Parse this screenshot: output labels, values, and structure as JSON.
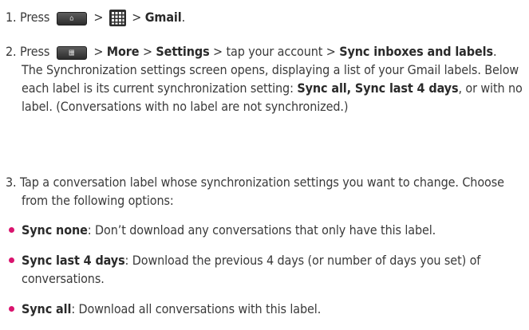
{
  "steps": [
    {
      "num": "1.",
      "press": "Press",
      "sep1": ">",
      "sep2": ">",
      "target": "Gmail",
      "end": "."
    },
    {
      "num": "2.",
      "press": "Press",
      "sep1": ">",
      "more": "More",
      "sep2": ">",
      "settings": "Settings",
      "sep3": "> tap your account >",
      "sync_inboxes": "Sync inboxes and labels",
      "end": ".",
      "para_a": "The Synchronization settings screen opens, displaying a list of your Gmail labels. Below each label is its current synchronization setting: ",
      "sync_all": "Sync all, Sync last 4 days",
      "para_b": ", or with no label. (Conversations with no label are not synchronized.)"
    },
    {
      "num": "3.",
      "text": "Tap a conversation label whose synchronization settings you want to change. Choose from the following options:",
      "options": [
        {
          "term": "Sync none",
          "desc": ": Don’t download any conversations that only have this label."
        },
        {
          "term": "Sync last 4 days",
          "desc": ": Download the previous 4 days (or number of days you set) of conversations."
        },
        {
          "term": "Sync all",
          "desc": ": Download all conversations with this label."
        }
      ]
    }
  ],
  "icons": {
    "home_key": "home-key-icon",
    "menu_key": "menu-key-icon",
    "apps_grid": "apps-grid-icon"
  },
  "colors": {
    "text": "#3a3a3a",
    "bullet": "#d9146e",
    "key": "#3a3a3a"
  }
}
